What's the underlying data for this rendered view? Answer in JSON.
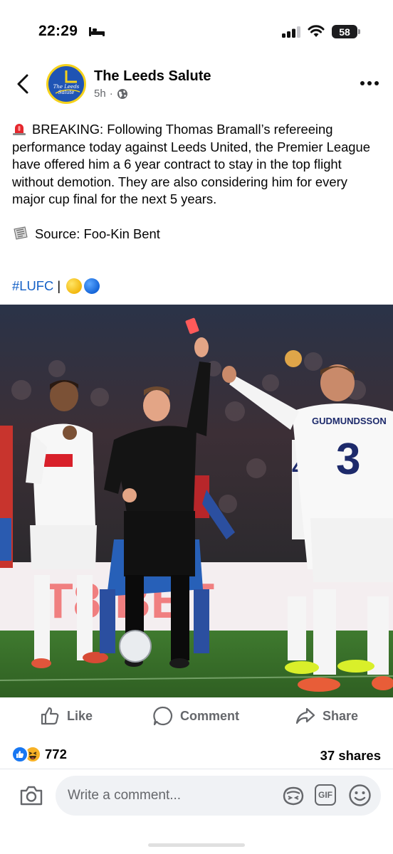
{
  "status_bar": {
    "time": "22:29",
    "battery": "58",
    "icons": [
      "bed-icon",
      "signal-icon",
      "wifi-icon",
      "battery-icon"
    ]
  },
  "header": {
    "page_name": "The Leeds Salute",
    "avatar_text": "The Leeds Salute",
    "time_ago": "5h",
    "separator": "·",
    "icons": [
      "back-arrow-icon",
      "globe-icon",
      "more-options-icon"
    ]
  },
  "post": {
    "paragraph_1": "BREAKING: Following Thomas Bramall’s refereeing performance today against Leeds United, the Premier League have offered him a 6 year contract to stay in the top flight without demotion. They are also considering him for every major cup final for the next 5 years.",
    "paragraph_2": "Source: Foo-Kin Bent",
    "hashtag": "#LUFC",
    "hashtag_separator": " | ",
    "icons": [
      "siren-icon",
      "newspaper-icon",
      "yellow-circle-emoji",
      "blue-circle-emoji"
    ],
    "image": {
      "board_text": "T8 BET",
      "shirt_name": "GUDMUNDSSON",
      "shirt_number": "3",
      "shirt_number_partial": "4"
    }
  },
  "actions": {
    "like": "Like",
    "comment": "Comment",
    "share": "Share"
  },
  "engagement": {
    "reaction_count": "772",
    "shares": "37 shares",
    "reaction_icons": [
      "like-reaction-icon",
      "haha-reaction-icon"
    ]
  },
  "comment_bar": {
    "placeholder": "Write a comment...",
    "gif_label": "GIF",
    "icons": [
      "camera-icon",
      "avatar-sticker-icon",
      "gif-icon",
      "emoji-icon"
    ]
  },
  "colors": {
    "link": "#1460c6",
    "secondary_text": "#65676b",
    "reaction_blue": "#1877f2",
    "input_bg": "#f0f2f5"
  }
}
